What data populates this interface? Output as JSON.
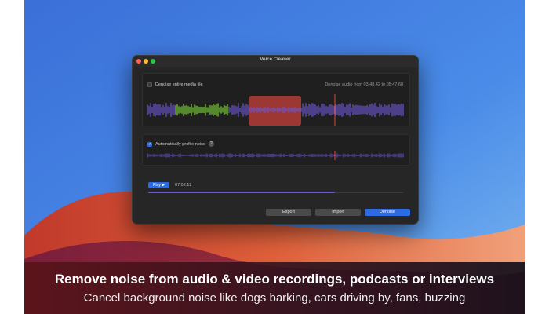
{
  "window": {
    "title": "Voice Cleaner",
    "denoise_entire_label": "Denoise entire media file",
    "denoise_entire_checked": false,
    "range_label": "Denoise audio from 03:48.42 to 05:47.60",
    "auto_profile_label": "Automatically profile noise",
    "auto_profile_checked": true,
    "help_glyph": "?",
    "play_label": "Play ▶",
    "play_time": "07:02.12",
    "playback_progress": 0.73,
    "export_label": "Export",
    "import_label": "Import",
    "denoise_label": "Denoise"
  },
  "caption": {
    "headline": "Remove noise from audio & video recordings, podcasts or interviews",
    "subline": "Cancel background noise like dogs barking, cars driving by, fans, buzzing"
  },
  "colors": {
    "accent_blue": "#2d6be4",
    "waveform_purple": "#6e56cf",
    "waveform_green": "#7bd13a",
    "selection_red": "#c8403c",
    "playhead": "#e04a3a"
  },
  "icons": [
    "checkbox-icon",
    "help-icon",
    "play-icon"
  ]
}
